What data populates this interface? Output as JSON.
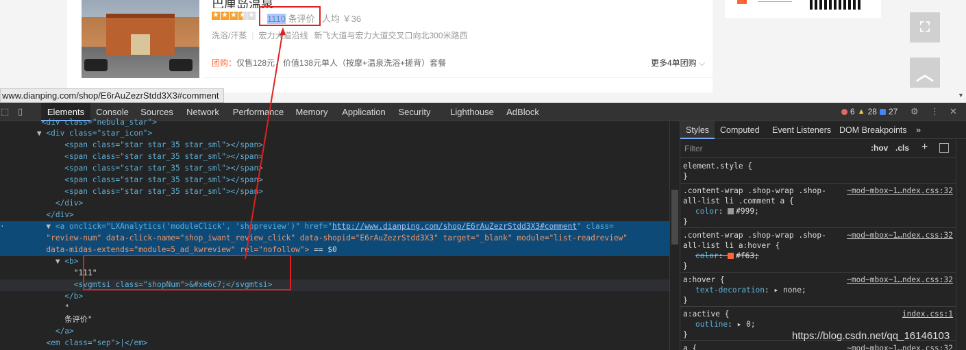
{
  "page": {
    "shop_title": "巴厘岛温泉",
    "rating_class": "star_35",
    "review": {
      "count": "1110",
      "suffix": " 条评价"
    },
    "avg_price": "人均 ￥36",
    "tags": [
      "洗浴/汗蒸",
      "宏力大道沿线",
      "新飞大道与宏力大道交叉口向北300米路西"
    ],
    "group_label": "团购：",
    "group_text": "仅售128元，价值138元单人（按摩+温泉洗浴+搓背）套餐",
    "more_deals": "更多4单团购",
    "status_url": "www.dianping.com/shop/E6rAuZezrStdd3X3#comment"
  },
  "devtools": {
    "tabs": [
      "Elements",
      "Console",
      "Sources",
      "Network",
      "Performance",
      "Memory",
      "Application",
      "Security",
      "Lighthouse",
      "AdBlock"
    ],
    "active_tab": "Elements",
    "errors": "6",
    "warnings": "28",
    "info": "27",
    "code": {
      "l0_tag": "<div class=\"nebula_star\">",
      "l1": "<div class=\"star_icon\">",
      "span_line": "<span class=\"star star_35 star_sml\"></span>",
      "close_div": "</div>",
      "a_l1a": "<a onclick=\"LXAnalytics('moduleClick', 'shopreview')\" href=\"",
      "a_href": "http://www.dianping.com/shop/E6rAuZezrStdd3X3#comment",
      "a_l1b": "\" class=",
      "a_l2": "\"review-num\" data-click-name=\"shop_iwant_review_click\" data-shopid=\"E6rAuZezrStdd3X3\" target=\"_blank\" module=\"list-readreview\"",
      "a_l3": "data-midas-extends=\"module=5_ad_kwreview\" rel=\"nofollow\">",
      "eq": " == $0",
      "b_open": "<b>",
      "b_text": "\"111\"",
      "svg_line": "<svgmtsi class=\"shopNum\">&#xe6c7;</svgmtsi>",
      "b_close": "</b>",
      "q1": "\"",
      "q2": "条评价\"",
      "a_close": "</a>",
      "em_line": "<em class=\"sep\">|</em>"
    },
    "styles": {
      "tabs": [
        "Styles",
        "Computed",
        "Event Listeners",
        "DOM Breakpoints"
      ],
      "filter_placeholder": "Filter",
      "hov": ":hov",
      "cls": ".cls",
      "rules": [
        {
          "selector": "element.style {",
          "source": "",
          "props": []
        },
        {
          "selector": ".content-wrap .shop-wrap .shop-\nall-list li .comment a {",
          "source": "~mod~mbox~1…ndex.css:32",
          "props": [
            {
              "name": "color",
              "value": "#999;",
              "swatch": "#999999",
              "strike": false
            }
          ]
        },
        {
          "selector": ".content-wrap .shop-wrap .shop-\nall-list li a:hover {",
          "source": "~mod~mbox~1…ndex.css:32",
          "props": [
            {
              "name": "color",
              "value": "#f63;",
              "swatch": "#ff6633",
              "strike": true
            }
          ]
        },
        {
          "selector": "a:hover {",
          "source": "~mod~mbox~1…ndex.css:32",
          "props": [
            {
              "name": "text-decoration",
              "value": "none;",
              "swatch": "",
              "strike": false
            }
          ]
        },
        {
          "selector": "a:active {",
          "source": "index.css:1",
          "props": [
            {
              "name": "outline",
              "value": "0;",
              "swatch": "",
              "strike": false
            }
          ]
        },
        {
          "selector": "a {",
          "source": "~mod~mbox~1…ndex.css:32",
          "props": []
        }
      ]
    }
  },
  "watermark": "https://blog.csdn.net/qq_16146103"
}
